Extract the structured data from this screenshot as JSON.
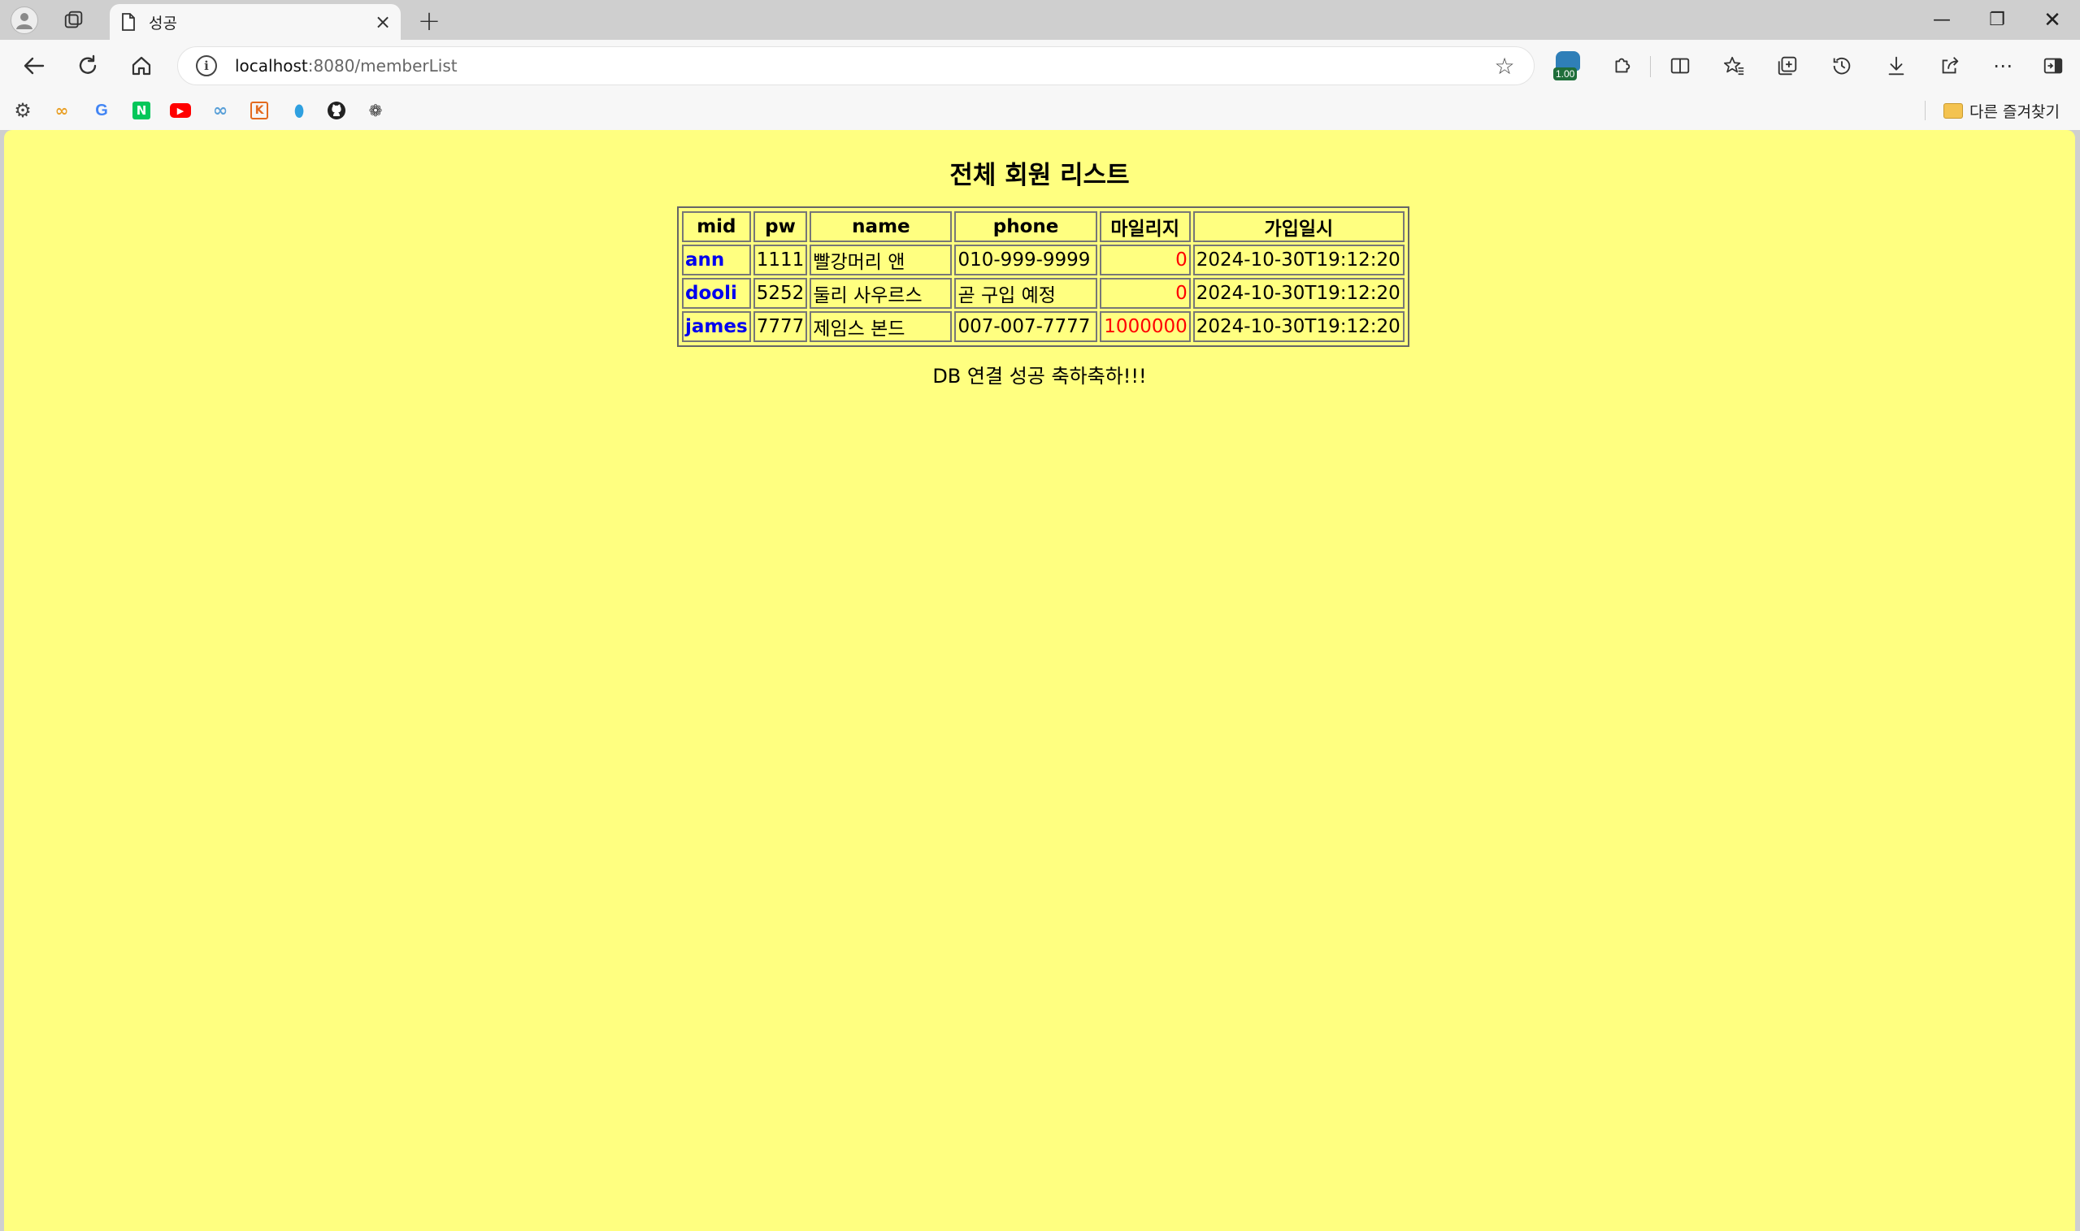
{
  "tab": {
    "title": "성공",
    "close_glyph": "×"
  },
  "window": {
    "new_tab_glyph": "+",
    "min_glyph": "—",
    "max_glyph": "❐",
    "close_glyph": "✕"
  },
  "toolbar": {
    "url_host": "localhost",
    "url_rest": ":8080/memberList",
    "extension_badge": "1.00"
  },
  "bookmarks": {
    "other_favorites": "다른 즐겨찾기",
    "items": [
      "settings-icon",
      "coupang-icon",
      "google-icon",
      "naver-icon",
      "youtube-icon",
      "infinity-icon",
      "k-icon",
      "droplet-icon",
      "github-icon",
      "openai-icon"
    ]
  },
  "page": {
    "title": "전체 회원 리스트",
    "footer": "DB 연결 성공 축하축하!!!",
    "columns": [
      "mid",
      "pw",
      "name",
      "phone",
      "마일리지",
      "가입일시"
    ],
    "rows": [
      {
        "mid": "ann",
        "pw": "1111",
        "name": "빨강머리 앤",
        "phone": "010-999-9999",
        "mileage": "0",
        "joined": "2024-10-30T19:12:20"
      },
      {
        "mid": "dooli",
        "pw": "5252",
        "name": "둘리 사우르스",
        "phone": "곧 구입 예정",
        "mileage": "0",
        "joined": "2024-10-30T19:12:20"
      },
      {
        "mid": "james",
        "pw": "7777",
        "name": "제임스 본드",
        "phone": "007-007-7777",
        "mileage": "1000000",
        "joined": "2024-10-30T19:12:20"
      }
    ]
  },
  "colors": {
    "page_background": "#ffff80",
    "link": "#0000ee",
    "mileage": "#ff0000"
  }
}
